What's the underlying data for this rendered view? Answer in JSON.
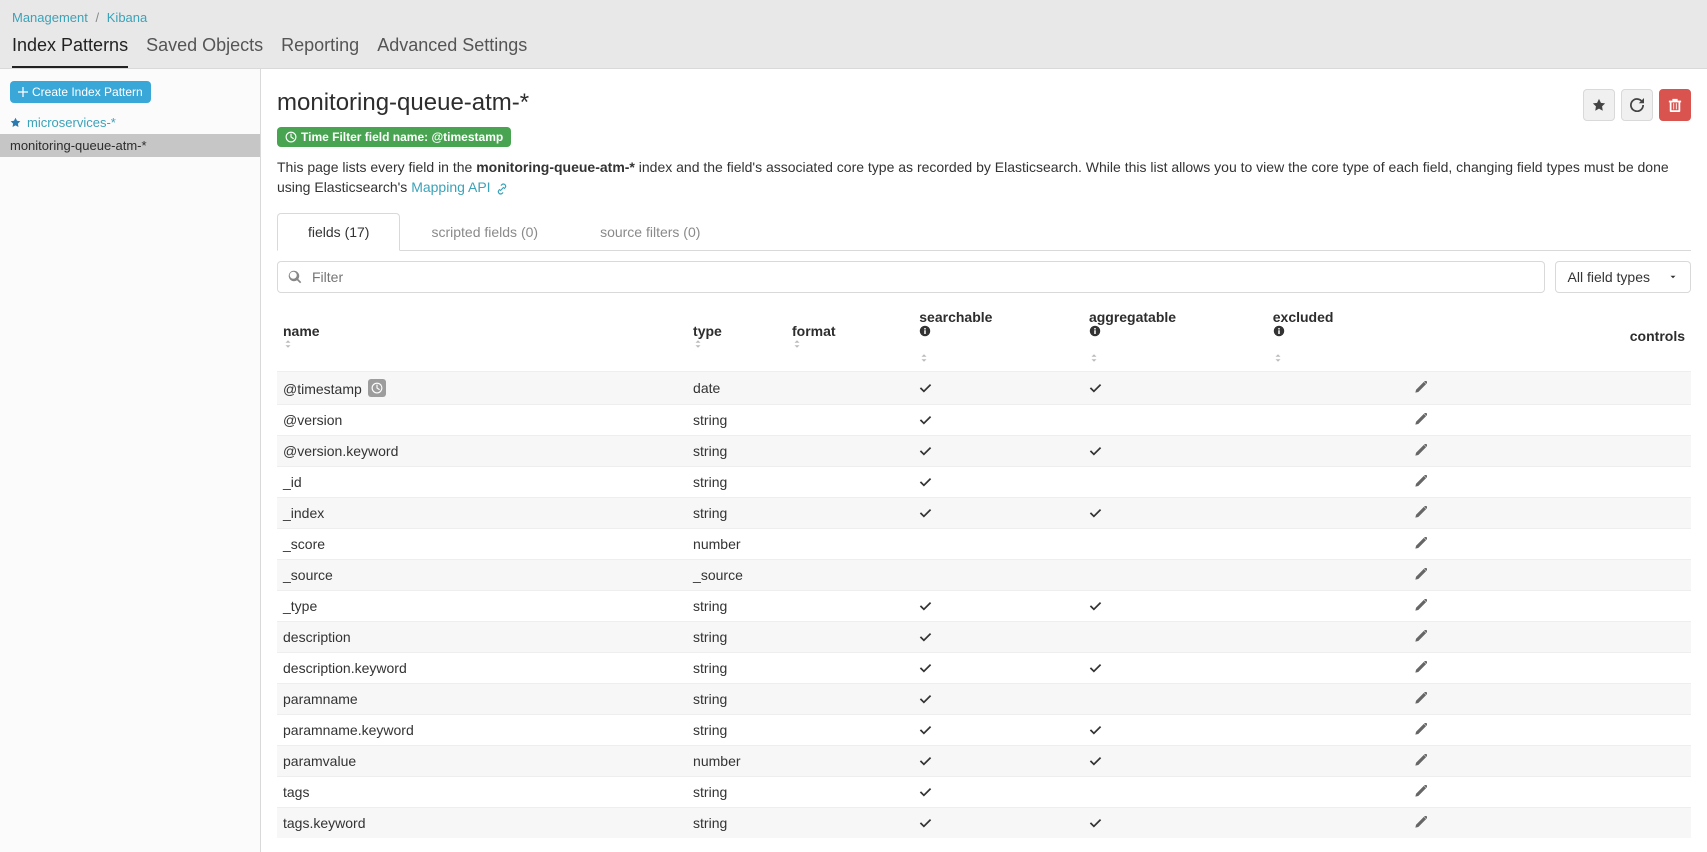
{
  "breadcrumb": {
    "parent": "Management",
    "child": "Kibana"
  },
  "top_tabs": [
    {
      "label": "Index Patterns",
      "active": true
    },
    {
      "label": "Saved Objects",
      "active": false
    },
    {
      "label": "Reporting",
      "active": false
    },
    {
      "label": "Advanced Settings",
      "active": false
    }
  ],
  "sidebar": {
    "create_button": "Create Index Pattern",
    "items": [
      {
        "label": "microservices-*",
        "starred": true,
        "selected": false
      },
      {
        "label": "monitoring-queue-atm-*",
        "starred": false,
        "selected": true
      }
    ]
  },
  "header": {
    "title": "monitoring-queue-atm-*",
    "badge_prefix": "Time Filter field name: ",
    "badge_value": "@timestamp"
  },
  "description": {
    "pre": "This page lists every field in the ",
    "bold": "monitoring-queue-atm-*",
    "mid": " index and the field's associated core type as recorded by Elasticsearch. While this list allows you to view the core type of each field, changing field types must be done using Elasticsearch's ",
    "link": "Mapping API"
  },
  "subtabs": [
    {
      "label": "fields (17)",
      "active": true
    },
    {
      "label": "scripted fields (0)",
      "active": false
    },
    {
      "label": "source filters (0)",
      "active": false
    }
  ],
  "filter": {
    "placeholder": "Filter"
  },
  "type_dropdown": "All field types",
  "columns": {
    "name": "name",
    "type": "type",
    "format": "format",
    "searchable": "searchable",
    "aggregatable": "aggregatable",
    "excluded": "excluded",
    "controls": "controls"
  },
  "rows": [
    {
      "name": "@timestamp",
      "type": "date",
      "clock": true,
      "searchable": true,
      "aggregatable": true
    },
    {
      "name": "@version",
      "type": "string",
      "searchable": true,
      "aggregatable": false
    },
    {
      "name": "@version.keyword",
      "type": "string",
      "searchable": true,
      "aggregatable": true
    },
    {
      "name": "_id",
      "type": "string",
      "searchable": true,
      "aggregatable": false
    },
    {
      "name": "_index",
      "type": "string",
      "searchable": true,
      "aggregatable": true
    },
    {
      "name": "_score",
      "type": "number",
      "searchable": false,
      "aggregatable": false
    },
    {
      "name": "_source",
      "type": "_source",
      "searchable": false,
      "aggregatable": false
    },
    {
      "name": "_type",
      "type": "string",
      "searchable": true,
      "aggregatable": true
    },
    {
      "name": "description",
      "type": "string",
      "searchable": true,
      "aggregatable": false
    },
    {
      "name": "description.keyword",
      "type": "string",
      "searchable": true,
      "aggregatable": true
    },
    {
      "name": "paramname",
      "type": "string",
      "searchable": true,
      "aggregatable": false
    },
    {
      "name": "paramname.keyword",
      "type": "string",
      "searchable": true,
      "aggregatable": true
    },
    {
      "name": "paramvalue",
      "type": "number",
      "searchable": true,
      "aggregatable": true
    },
    {
      "name": "tags",
      "type": "string",
      "searchable": true,
      "aggregatable": false
    },
    {
      "name": "tags.keyword",
      "type": "string",
      "searchable": true,
      "aggregatable": true
    }
  ]
}
